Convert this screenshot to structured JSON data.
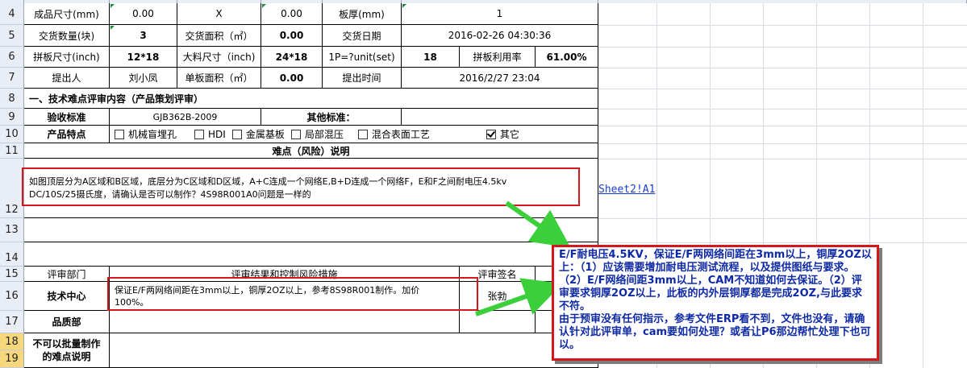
{
  "row_numbers": [
    "4",
    "5",
    "6",
    "7",
    "8",
    "9",
    "10",
    "11",
    "12",
    "13",
    "14",
    "15",
    "16",
    "17",
    "18",
    "19"
  ],
  "r4": {
    "label1": "成品尺寸(mm)",
    "v1": "0.00",
    "x": "X",
    "v2": "0.00",
    "label2": "板厚(mm)",
    "v3": "1"
  },
  "r5": {
    "label1": "交货数量(块)",
    "v1": "3",
    "label2": "交货面积（㎡）",
    "v2": "0.00",
    "label3": "交货日期",
    "v3": "2016-02-26 04:30:36"
  },
  "r6": {
    "label1": "拼板尺寸(inch)",
    "v1": "12*18",
    "label2": "大料尺寸（inch)",
    "v2": "24*18",
    "label3": "1P=?unit(set)",
    "v3": "18",
    "label4": "拼板利用率",
    "v4": "61.00%"
  },
  "r7": {
    "label1": "提出人",
    "v1": "刘小凤",
    "label2": "单板面积（㎡）",
    "v2": "0.00",
    "label3": "提出时间",
    "v3": "2016/2/27 23:04"
  },
  "r8": {
    "text": "一、技术难点评审内容（产品策划评审）"
  },
  "r9": {
    "label1": "验收标准",
    "v1": "GJB362B-2009",
    "label2": "其他标准："
  },
  "r10": {
    "label": "产品特点",
    "options": [
      {
        "text": "机械盲埋孔",
        "checked": false
      },
      {
        "text": "HDI",
        "checked": false
      },
      {
        "text": "金属基板",
        "checked": false
      },
      {
        "text": "局部混压",
        "checked": false
      },
      {
        "text": "混合表面工艺",
        "checked": false
      },
      {
        "text": "其它",
        "checked": true
      }
    ]
  },
  "r11": {
    "text": "难点（风险）说明"
  },
  "r12": {
    "line1": "如图顶层分为A区域和B区域，底层分为C区域和D区域，A+C连成一个网络E,B+D连成一个网络F，E和F之间耐电压4.5kv",
    "line2": "DC/10S/25摄氏度，请确认是否可以制作？4S98R001A0问题是一样的",
    "link": "Sheet2!A1"
  },
  "r15": {
    "dept": "评审部门",
    "result": "评审结果和控制风险措施",
    "sign": "评审签名"
  },
  "r16": {
    "dept": "技术中心",
    "line1": "保证E/F两网络间距在3mm以上，铜厚2OZ以上，参考8S98R001制作。加价",
    "line2": "100%。",
    "sign": "张勃"
  },
  "r17": {
    "dept": "品质部"
  },
  "r18": {
    "line1": "不可以批量制作",
    "line2": "的难点说明"
  },
  "note": {
    "text": "E/F耐电压4.5KV，保证E/F两网络间距在3mm以上，铜厚2OZ以上：（1）应该需要增加耐电压测试流程，以及提供图纸与要求。（2）E/F网络间距3mm以上，CAM不知道如何去保证。（2）评审要求铜厚2OZ以上，此板的内外层铜厚都是完成2OZ,与此要求不符。\n由于预审没有任何指示，参考文件ERP看不到，文件也没有，请确认针对此评审单，cam要如何处理？或者让P6那边帮忙处理下也可以。"
  },
  "colors": {
    "annotation_red": "#d3171c",
    "annotation_text": "#0f2aa6",
    "arrow": "#3ccf3c",
    "link": "#1a3fd0"
  }
}
